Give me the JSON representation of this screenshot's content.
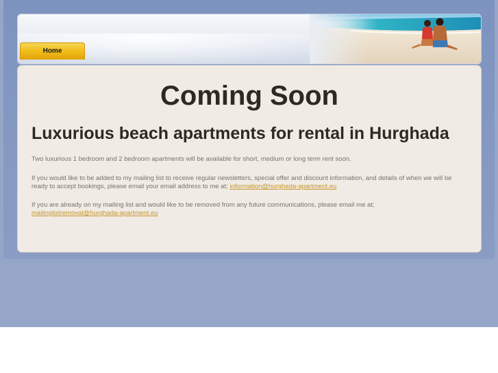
{
  "nav": {
    "home_label": "Home"
  },
  "content": {
    "heading": "Coming Soon",
    "subheading": "Luxurious beach apartments for rental in Hurghada",
    "paragraph1": "Two luxurious 1 bedroom and 2 bedroom apartments will be available for short, medium or long term rent soon.",
    "paragraph2_text": "If you would like to be added to my mailing list to receive regular newsletters, special offer and discount information, and details of when we will be ready to accept bookings, please email your email address to me at; ",
    "paragraph2_link": "information@hurghada-apartment.eu",
    "paragraph3_text": "If you are already on my mailing list and would like to be removed from any future communications, please email me at; ",
    "paragraph3_link": "mailinglistremoval@hurghada-apartment.eu"
  },
  "colors": {
    "page_background": "#95a6c8",
    "content_background": "#f0ebe5",
    "heading_text": "#2f2921",
    "body_text": "#77736d",
    "link": "#c6962a",
    "nav_tab": "#f1bf1a"
  },
  "icons": {
    "header_image": "beach-couple-image"
  }
}
